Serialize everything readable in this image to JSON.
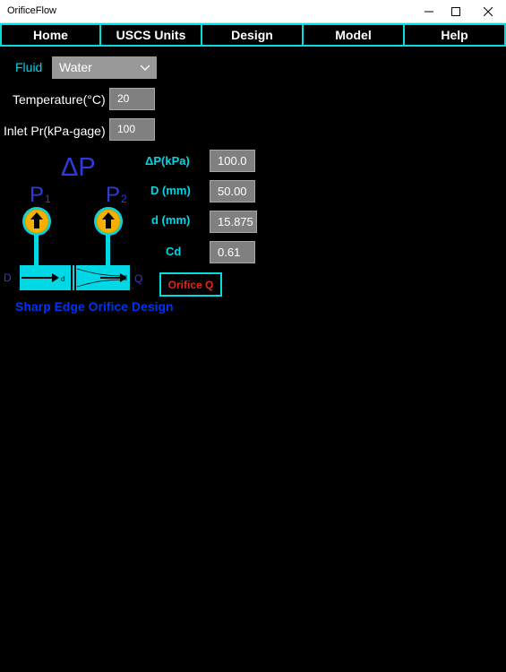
{
  "window": {
    "title": "OrificeFlow"
  },
  "nav": {
    "items": [
      "Home",
      "USCS Units",
      "Design",
      "Model",
      "Help"
    ]
  },
  "form": {
    "fluid_label": "Fluid",
    "fluid_value": "Water",
    "temperature_label": "Temperature(°C)",
    "temperature_value": "20",
    "inlet_label": "Inlet Pr(kPa-gage)",
    "inlet_value": "100"
  },
  "diagram": {
    "delta_p": "ΔP",
    "p1": "P",
    "p1_sub": "1",
    "p2": "P",
    "p2_sub": "2",
    "d_upper": "D",
    "d_small": "d",
    "q": "Q",
    "caption": "Sharp Edge Orifice Design"
  },
  "params": {
    "dp_label": "ΔP(kPa)",
    "dp_value": "100.0",
    "D_label": "D (mm)",
    "D_value": "50.00",
    "d_label": "d (mm)",
    "d_value": "15.875",
    "cd_label": "Cd",
    "cd_value": "0.61"
  },
  "actions": {
    "orifice_q": "Orifice Q"
  },
  "colors": {
    "accent": "#00dede",
    "label": "#00d8e6",
    "design": "#0033ee",
    "button_text": "#e0281a"
  }
}
